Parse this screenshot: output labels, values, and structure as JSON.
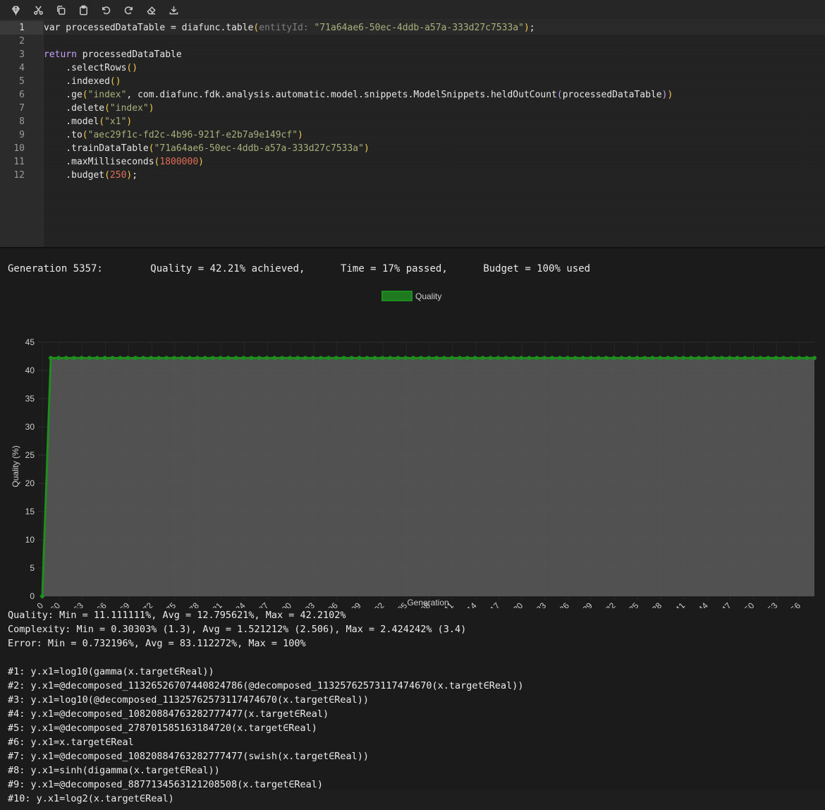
{
  "toolbar": {
    "buttons": [
      "gem",
      "cut",
      "copy",
      "paste",
      "undo",
      "redo",
      "eraser",
      "download"
    ]
  },
  "editor": {
    "line_numbers": [
      "1",
      "2",
      "3",
      "4",
      "5",
      "6",
      "7",
      "8",
      "9",
      "10",
      "11",
      "12"
    ],
    "lines": [
      {
        "parts": [
          [
            "",
            "var processedDataTable = diafunc.table"
          ],
          [
            "paren",
            "("
          ],
          [
            "hint",
            "entityId: "
          ],
          [
            "str",
            "\"71a64ae6-50ec-4ddb-a57a-333d27c7533a\""
          ],
          [
            "paren",
            ")"
          ],
          [
            "",
            ";"
          ]
        ]
      },
      {
        "parts": []
      },
      {
        "parts": [
          [
            "kw",
            "return"
          ],
          [
            "",
            " processedDataTable"
          ]
        ]
      },
      {
        "parts": [
          [
            "",
            "    .selectRows"
          ],
          [
            "paren",
            "()"
          ]
        ]
      },
      {
        "parts": [
          [
            "",
            "    .indexed"
          ],
          [
            "paren",
            "()"
          ]
        ]
      },
      {
        "parts": [
          [
            "",
            "    .ge"
          ],
          [
            "paren",
            "("
          ],
          [
            "str",
            "\"index\""
          ],
          [
            "",
            ", com.diafunc.fdk.analysis.automatic.model.snippets.ModelSnippets.heldOutCount"
          ],
          [
            "kw",
            "("
          ],
          [
            "",
            "processedDataTable"
          ],
          [
            "kw",
            ")"
          ],
          [
            "paren",
            ")"
          ]
        ]
      },
      {
        "parts": [
          [
            "",
            "    .delete"
          ],
          [
            "paren",
            "("
          ],
          [
            "str",
            "\"index\""
          ],
          [
            "paren",
            ")"
          ]
        ]
      },
      {
        "parts": [
          [
            "",
            "    .model"
          ],
          [
            "paren",
            "("
          ],
          [
            "str",
            "\"x1\""
          ],
          [
            "paren",
            ")"
          ]
        ]
      },
      {
        "parts": [
          [
            "",
            "    .to"
          ],
          [
            "paren",
            "("
          ],
          [
            "str",
            "\"aec29f1c-fd2c-4b96-921f-e2b7a9e149cf\""
          ],
          [
            "paren",
            ")"
          ]
        ]
      },
      {
        "parts": [
          [
            "",
            "    .trainDataTable"
          ],
          [
            "paren",
            "("
          ],
          [
            "str",
            "\"71a64ae6-50ec-4ddb-a57a-333d27c7533a\""
          ],
          [
            "paren",
            ")"
          ]
        ]
      },
      {
        "parts": [
          [
            "",
            "    .maxMilliseconds"
          ],
          [
            "paren",
            "("
          ],
          [
            "num",
            "1800000"
          ],
          [
            "paren",
            ")"
          ]
        ]
      },
      {
        "parts": [
          [
            "",
            "    .budget"
          ],
          [
            "paren",
            "("
          ],
          [
            "num",
            "250"
          ],
          [
            "paren",
            ")"
          ],
          [
            "",
            ";"
          ]
        ]
      }
    ]
  },
  "status": {
    "generation": "Generation 5357:",
    "quality": "Quality = 42.21% achieved,",
    "time": "Time = 17% passed,",
    "budget": "Budget = 100% used"
  },
  "colors": {
    "line": "#1d8f1d",
    "fill": "#5a5a5a",
    "legend_box": "#1f7a1f"
  },
  "chart_data": {
    "type": "area",
    "legend": [
      "Quality"
    ],
    "legend_position": "top-center",
    "xlabel": "Generation",
    "ylabel": "Quality (%)",
    "ylim": [
      0,
      45
    ],
    "yticks": [
      0,
      5,
      10,
      15,
      20,
      25,
      30,
      35,
      40,
      45
    ],
    "grid": true,
    "x_tick_labels": [
      "0",
      "5260",
      "5263",
      "5266",
      "5269",
      "5272",
      "5275",
      "5278",
      "5281",
      "5284",
      "5287",
      "5290",
      "5293",
      "5296",
      "5299",
      "5302",
      "5305",
      "5308",
      "5311",
      "5314",
      "5317",
      "5320",
      "5323",
      "5326",
      "5329",
      "5332",
      "5335",
      "5338",
      "5341",
      "5344",
      "5347",
      "5350",
      "5353",
      "5356"
    ],
    "series": [
      {
        "name": "Quality",
        "x": [
          0,
          5258,
          5357
        ],
        "values_note_free": true,
        "start": {
          "x": 0,
          "y": 0
        },
        "plateau": {
          "from": 5258,
          "to": 5357,
          "y": 42.21
        }
      }
    ]
  },
  "stats": {
    "lines": [
      "Quality: Min = 11.111111%, Avg = 12.795621%, Max = 42.2102%",
      "Complexity: Min = 0.30303% (1.3), Avg = 1.521212% (2.506), Max = 2.424242% (3.4)",
      "Error: Min = 0.732196%, Avg = 83.112272%, Max = 100%",
      "",
      "#1: y.x1=log10(gamma(x.target∈Real))",
      "#2: y.x1=@decomposed_11326526707440824786(@decomposed_11325762573117474670(x.target∈Real))",
      "#3: y.x1=log10(@decomposed_11325762573117474670(x.target∈Real))",
      "#4: y.x1=@decomposed_10820884763282777477(x.target∈Real)",
      "#5: y.x1=@decomposed_278701585163184720(x.target∈Real)",
      "#6: y.x1=x.target∈Real",
      "#7: y.x1=@decomposed_10820884763282777477(swish(x.target∈Real))",
      "#8: y.x1=sinh(digamma(x.target∈Real))",
      "#9: y.x1=@decomposed_8877134563121208508(x.target∈Real)",
      "#10: y.x1=log2(x.target∈Real)"
    ]
  }
}
